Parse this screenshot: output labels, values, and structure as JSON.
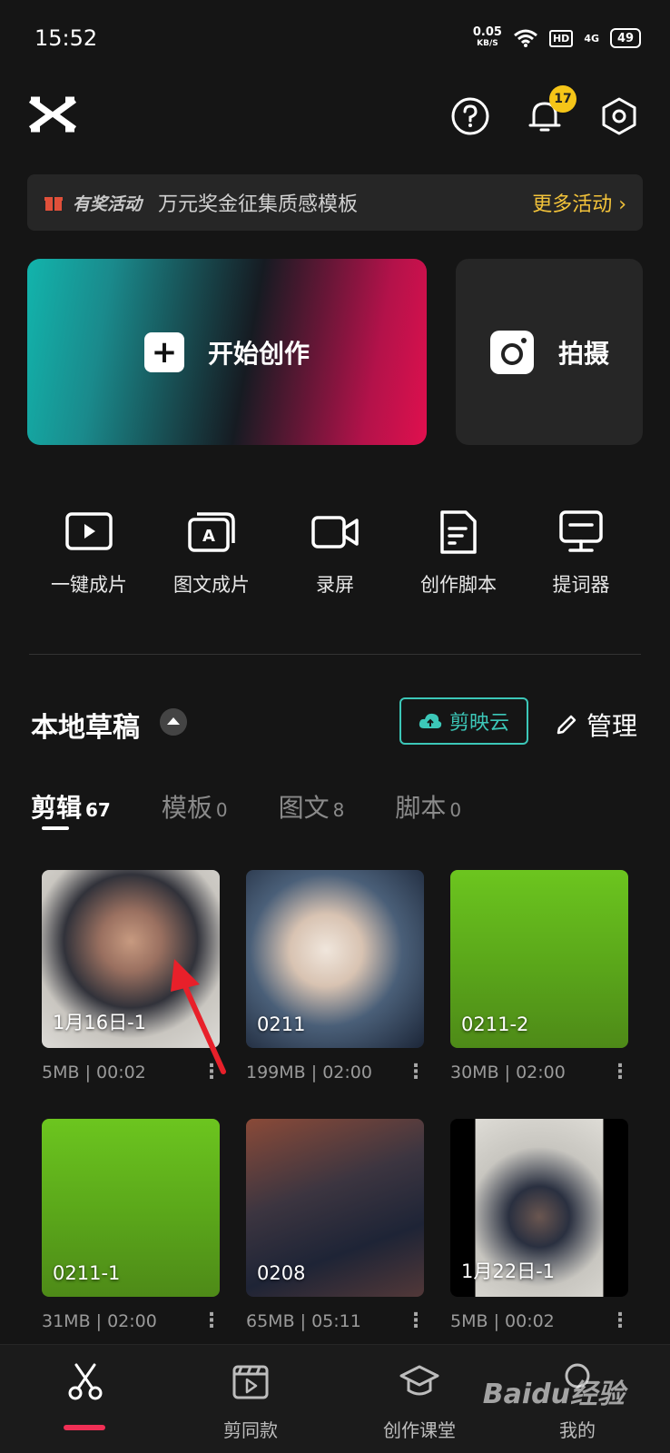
{
  "status_bar": {
    "time": "15:52",
    "net_speed": "0.05",
    "net_unit": "KB/S",
    "hd": "HD",
    "signal": "4G",
    "battery": "49"
  },
  "header": {
    "notification_count": "17"
  },
  "banner": {
    "tag": "有奖活动",
    "text": "万元奖金征集质感模板",
    "more": "更多活动 ›"
  },
  "main_actions": {
    "create_label": "开始创作",
    "shoot_label": "拍摄"
  },
  "tools": [
    {
      "label": "一键成片"
    },
    {
      "label": "图文成片"
    },
    {
      "label": "录屏"
    },
    {
      "label": "创作脚本"
    },
    {
      "label": "提词器"
    }
  ],
  "drafts": {
    "title": "本地草稿",
    "cloud_label": "剪映云",
    "manage_label": "管理",
    "tabs": [
      {
        "label": "剪辑",
        "count": "67"
      },
      {
        "label": "模板",
        "count": "0"
      },
      {
        "label": "图文",
        "count": "8"
      },
      {
        "label": "脚本",
        "count": "0"
      }
    ],
    "items": [
      {
        "title": "1月16日-1",
        "size": "5MB",
        "duration": "00:02"
      },
      {
        "title": "0211",
        "size": "199MB",
        "duration": "02:00"
      },
      {
        "title": "0211-2",
        "size": "30MB",
        "duration": "02:00"
      },
      {
        "title": "0211-1",
        "size": "31MB",
        "duration": "02:00"
      },
      {
        "title": "0208",
        "size": "65MB",
        "duration": "05:11"
      },
      {
        "title": "1月22日-1",
        "size": "5MB",
        "duration": "00:02"
      }
    ]
  },
  "bottom_nav": {
    "items": [
      {
        "label": ""
      },
      {
        "label": "剪同款"
      },
      {
        "label": "创作课堂"
      },
      {
        "label": "我的"
      }
    ]
  },
  "watermark": "Baidu经验",
  "colors": {
    "accent_teal": "#3cc7b8",
    "accent_red": "#f02f55",
    "badge_yellow": "#f5c518",
    "banner_link": "#f3c33a"
  }
}
